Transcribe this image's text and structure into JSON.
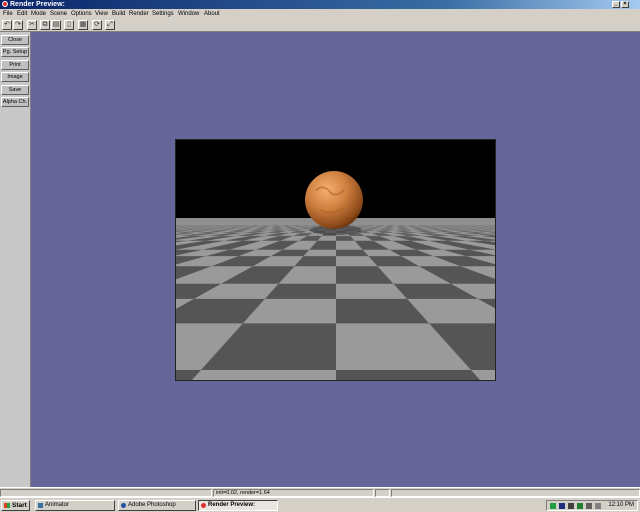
{
  "window": {
    "title": "Render Preview:"
  },
  "menu": [
    "File",
    "Edit",
    "Mode",
    "Scene",
    "Options",
    "View",
    "Build",
    "Render",
    "Settings",
    "Window",
    "About"
  ],
  "toolbar_icons": [
    "undo-icon",
    "redo-icon",
    "cut-icon",
    "copy-icon",
    "paste-icon",
    "page-icon",
    "grid-icon",
    "rotate-icon",
    "fit-icon"
  ],
  "sidebar": {
    "buttons": [
      "Close",
      "Pg. Setup",
      "Print",
      "Image",
      "Save",
      "Alpha Ch."
    ]
  },
  "status": {
    "render_info": "init=0.02, render=1.64"
  },
  "taskbar": {
    "start_label": "Start",
    "tasks": [
      {
        "label": "Animator",
        "active": false
      },
      {
        "label": "Adobe Photoshop",
        "active": false
      },
      {
        "label": "Render Preview:",
        "active": true
      }
    ],
    "clock": "12:10 PM"
  },
  "colors": {
    "viewport_bg": "#66669a",
    "title_bar": "#0a246a",
    "sphere": "#c8783a",
    "checker_light": "#9a9a9a",
    "checker_dark": "#555555"
  }
}
